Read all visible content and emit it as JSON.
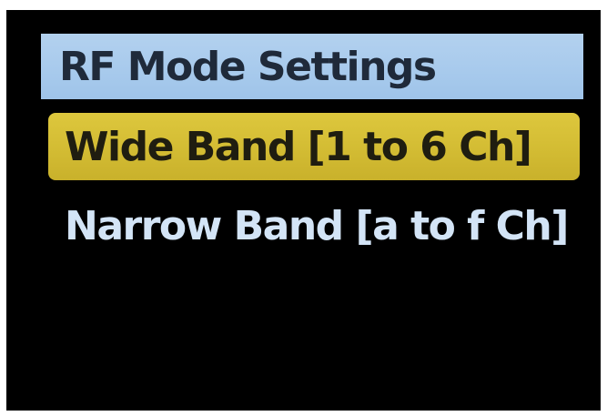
{
  "screen": {
    "title": "RF Mode Settings",
    "menu": [
      {
        "label": "Wide Band [1 to 6 Ch]",
        "selected": true
      },
      {
        "label": "Narrow Band [a to f Ch]",
        "selected": false
      }
    ]
  },
  "colors": {
    "background": "#000000",
    "title_bar": "#a9cbed",
    "selection_highlight": "#d4bd34",
    "unselected_text": "#d3e4f6"
  }
}
